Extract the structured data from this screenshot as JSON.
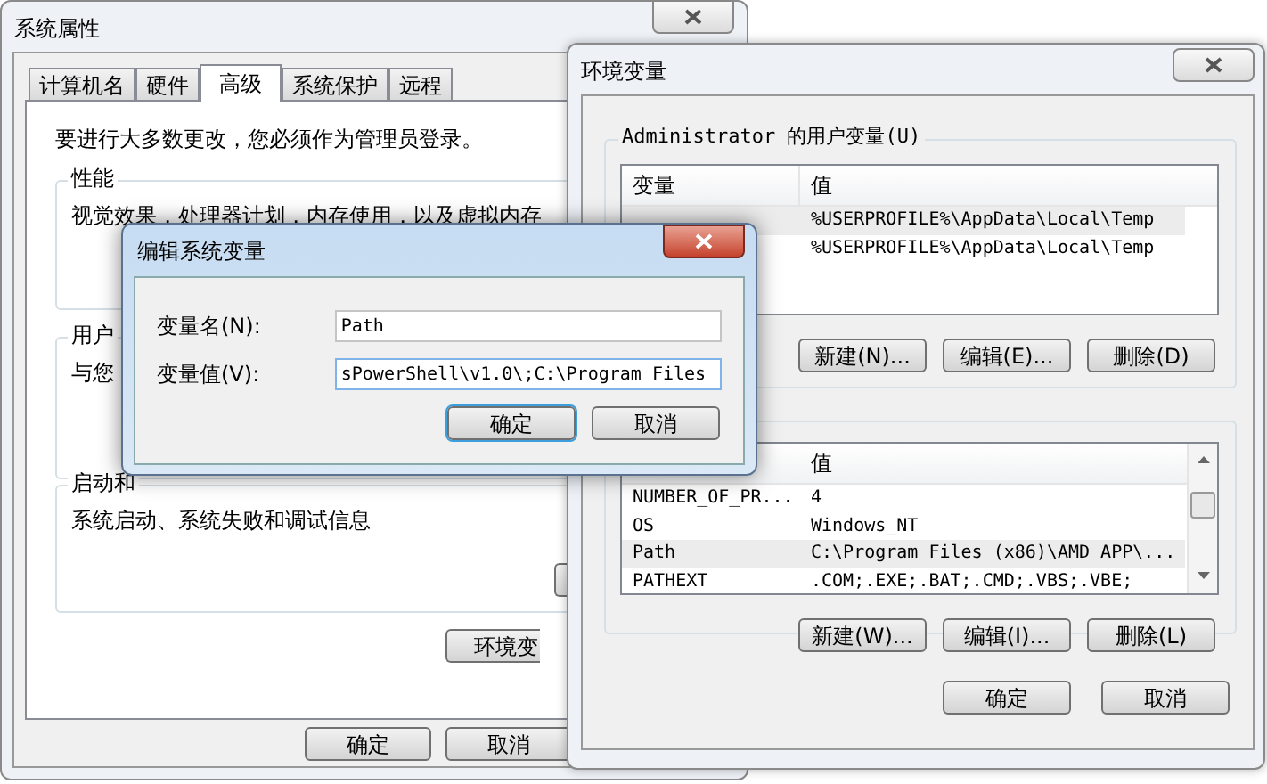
{
  "system_properties": {
    "title": "系统属性",
    "tabs": [
      {
        "label": "计算机名",
        "selected": false
      },
      {
        "label": "硬件",
        "selected": false
      },
      {
        "label": "高级",
        "selected": true
      },
      {
        "label": "系统保护",
        "selected": false
      },
      {
        "label": "远程",
        "selected": false
      }
    ],
    "notice": "要进行大多数更改，您必须作为管理员登录。",
    "groups": [
      {
        "label": "性能",
        "text": "视觉效果，处理器计划，内存使用，以及虚拟内存"
      },
      {
        "label": "用户",
        "text": "与您"
      },
      {
        "label": "启动和",
        "text": "系统启动、系统失败和调试信息"
      }
    ],
    "environment_button": "环境变",
    "buttons": [
      "确定",
      "取消"
    ]
  },
  "environment_variables": {
    "title": "环境变量",
    "user_group": {
      "label": "Administrator 的用户变量(U)",
      "columns": [
        "变量",
        "值"
      ],
      "rows": [
        {
          "value": "%USERPROFILE%\\AppData\\Local\\Temp",
          "selected": true
        },
        {
          "value": "%USERPROFILE%\\AppData\\Local\\Temp",
          "selected": false
        }
      ],
      "buttons": [
        "新建(N)...",
        "编辑(E)...",
        "删除(D)"
      ]
    },
    "system_group": {
      "columns": [
        "值"
      ],
      "rows": [
        {
          "variable": "NUMBER_OF_PR...",
          "value": "4",
          "selected": false
        },
        {
          "variable": "OS",
          "value": "Windows_NT",
          "selected": false
        },
        {
          "variable": "Path",
          "value": "C:\\Program Files (x86)\\AMD APP\\...",
          "selected": true
        },
        {
          "variable": "PATHEXT",
          "value": ".COM;.EXE;.BAT;.CMD;.VBS;.VBE;",
          "selected": false
        }
      ],
      "buttons": [
        "新建(W)...",
        "编辑(I)...",
        "删除(L)"
      ]
    },
    "buttons": [
      "确定",
      "取消"
    ]
  },
  "edit_dialog": {
    "title": "编辑系统变量",
    "fields": [
      {
        "label": "变量名(N):",
        "value": "Path"
      },
      {
        "label": "变量值(V):",
        "value": "sPowerShell\\v1.0\\;C:\\Program Files"
      }
    ],
    "buttons": [
      {
        "label": "确定",
        "default": true
      },
      {
        "label": "取消",
        "default": false
      }
    ]
  }
}
